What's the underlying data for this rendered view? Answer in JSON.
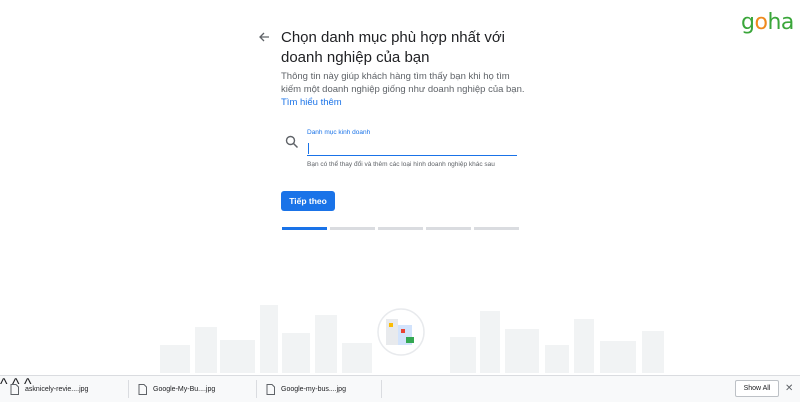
{
  "logo": {
    "g": "g",
    "o": "o",
    "ha": "ha"
  },
  "header": {
    "title": "Chọn danh mục phù hợp nhất với doanh nghiệp của bạn",
    "description": "Thông tin này giúp khách hàng tìm thấy bạn khi họ tìm kiếm một doanh nghiệp giống như doanh nghiệp của bạn.",
    "learn_more": "Tìm hiểu thêm"
  },
  "field": {
    "label": "Danh mục kinh doanh",
    "value": "",
    "helper": "Bạn có thể thay đổi và thêm các loại hình doanh nghiệp khác sau"
  },
  "next_button": "Tiếp theo",
  "progress": {
    "steps": 5,
    "current": 1
  },
  "downloads": {
    "items": [
      {
        "name": "asknicely-revie....jpg"
      },
      {
        "name": "Google-My-Bu....jpg"
      },
      {
        "name": "Google-my-bus....jpg"
      }
    ],
    "show_all": "Show All"
  },
  "colors": {
    "accent": "#1a73e8",
    "logo_green": "#3aa63a",
    "logo_orange": "#ef8a1e"
  }
}
